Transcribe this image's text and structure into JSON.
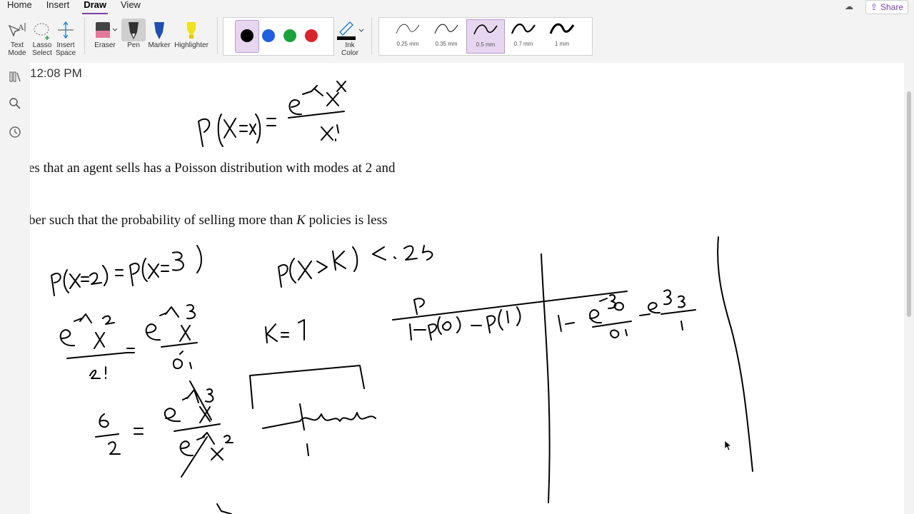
{
  "menu": {
    "home": "Home",
    "insert": "Insert",
    "draw": "Draw",
    "view": "View"
  },
  "share_label": "Share",
  "tools": {
    "text_mode_1": "Text",
    "text_mode_2": "Mode",
    "lasso_1": "Lasso",
    "lasso_2": "Select",
    "insert_space_1": "Insert",
    "insert_space_2": "Space",
    "eraser": "Eraser",
    "pen": "Pen",
    "marker": "Marker",
    "highlighter": "Highlighter",
    "ink_color_1": "Ink",
    "ink_color_2": "Color"
  },
  "colors": {
    "black": "#000000",
    "blue": "#1f5fe0",
    "green": "#1aa33c",
    "red": "#d9232d",
    "accent": "#7b3fa6"
  },
  "widths": [
    "0.25 mm",
    "0.35 mm",
    "0.5 mm",
    "0.7 mm",
    "1 mm"
  ],
  "selected_width": "0.5 mm",
  "note": {
    "time": "12:08 PM",
    "line1": "es that an agent sells has a Poisson distribution with modes at 2 and",
    "line2_a": "ber such that the probability of selling more than ",
    "line2_k": "K",
    "line2_b": " policies is less"
  }
}
